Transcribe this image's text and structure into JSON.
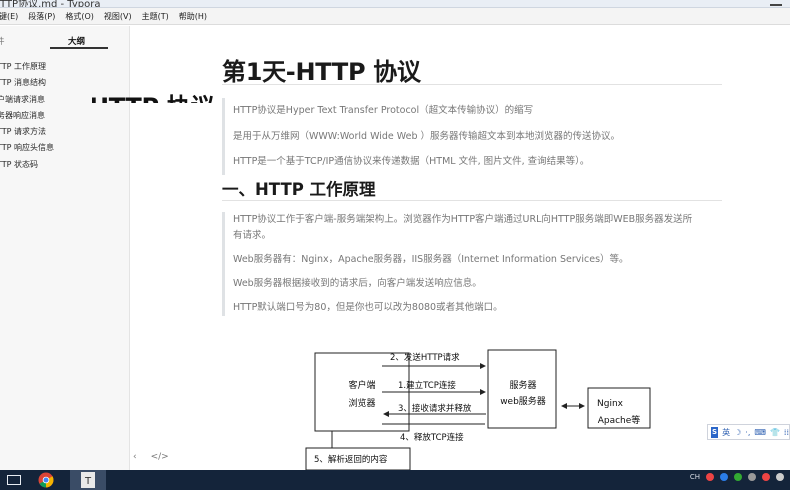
{
  "window": {
    "title": "TTP协议.md - Typora"
  },
  "menu": [
    "键(E)",
    "段落(P)",
    "格式(O)",
    "视图(V)",
    "主题(T)",
    "帮助(H)"
  ],
  "sidebar": {
    "tab_files": "件",
    "tab_outline": "大纲",
    "items": [
      {
        "label": "HTTP 协议",
        "level": "h1"
      },
      {
        "label": "TTP 工作原理",
        "level": "h2"
      },
      {
        "label": "TTP 消息结构",
        "level": "h2"
      },
      {
        "label": "户端请求消息",
        "level": "h2"
      },
      {
        "label": "务器响应消息",
        "level": "h2"
      },
      {
        "label": "TTP 请求方法",
        "level": "h2"
      },
      {
        "label": "TTP 响应头信息",
        "level": "h2"
      },
      {
        "label": "TTP 状态码",
        "level": "h2"
      }
    ],
    "back_icon": "‹",
    "source_icon": "</>"
  },
  "doc": {
    "h1": "第1天-HTTP 协议",
    "bq1": [
      "HTTP协议是Hyper Text Transfer Protocol（超文本传输协议）的缩写",
      "是用于从万维网（WWW:World Wide Web ）服务器传输超文本到本地浏览器的传送协议。",
      "HTTP是一个基于TCP/IP通信协议来传递数据（HTML 文件, 图片文件, 查询结果等）。"
    ],
    "h2": "一、HTTP 工作原理",
    "bq2": [
      "HTTP协议工作于客户端-服务端架构上。浏览器作为HTTP客户端通过URL向HTTP服务端即WEB服务器发送所",
      "有请求。",
      "Web服务器有：Nginx，Apache服务器，IIS服务器（Internet Information Services）等。",
      "Web服务器根据接收到的请求后，向客户端发送响应信息。",
      "HTTP默认端口号为80，但是你也可以改为8080或者其他端口。"
    ]
  },
  "diagram": {
    "client_line1": "客户端",
    "client_line2": "浏览器",
    "server_line1": "服务器",
    "server_line2": "web服务器",
    "nginx_line1": "Nginx",
    "nginx_line2": "Apache等",
    "step1": "2、发送HTTP请求",
    "step2": "1.建立TCP连接",
    "step3": "3、接收请求并释放",
    "step4": "4、释放TCP连接",
    "step5": "5、解析返回的内容"
  },
  "ime": {
    "label": "英"
  },
  "taskbar": {
    "tray_lang": "CH"
  },
  "colors": {
    "accent": "#2a66c9",
    "taskbar": "#14243a",
    "quote_text": "#777777"
  }
}
